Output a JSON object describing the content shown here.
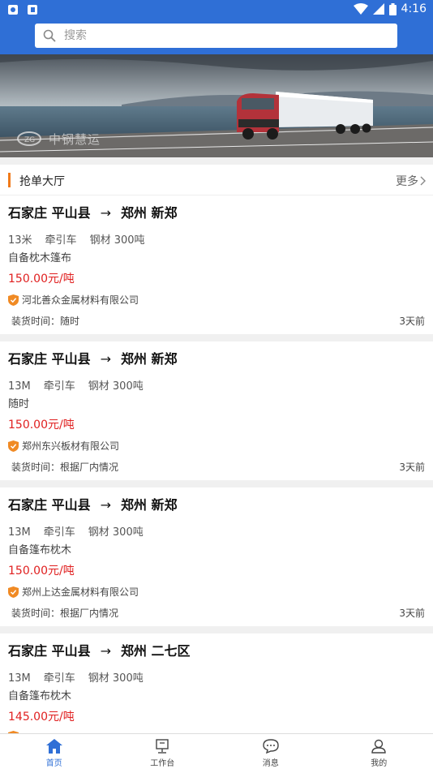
{
  "status_bar": {
    "time": "4:16"
  },
  "search": {
    "placeholder": "搜索"
  },
  "banner": {
    "watermark": "中钢慧运"
  },
  "section": {
    "title": "抢单大厅",
    "more": "更多"
  },
  "orders": [
    {
      "origin": "石家庄 平山县",
      "arrow": "→",
      "destination": "郑州 新郑",
      "length": "13米",
      "vehicle": "牵引车",
      "cargo": "钢材 300吨",
      "note": "自备枕木篷布",
      "price": "150.00元/吨",
      "company": "河北善众金属材料有限公司",
      "load_time": "装货时间：随时",
      "posted": "3天前"
    },
    {
      "origin": "石家庄 平山县",
      "arrow": "→",
      "destination": "郑州 新郑",
      "length": "13M",
      "vehicle": "牵引车",
      "cargo": "钢材 300吨",
      "note": "随时",
      "price": "150.00元/吨",
      "company": "郑州东兴板材有限公司",
      "load_time": "装货时间：根据厂内情况",
      "posted": "3天前"
    },
    {
      "origin": "石家庄 平山县",
      "arrow": "→",
      "destination": "郑州 新郑",
      "length": "13M",
      "vehicle": "牵引车",
      "cargo": "钢材 300吨",
      "note": "自备篷布枕木",
      "price": "150.00元/吨",
      "company": "郑州上达金属材料有限公司",
      "load_time": "装货时间：根据厂内情况",
      "posted": "3天前"
    },
    {
      "origin": "石家庄 平山县",
      "arrow": "→",
      "destination": "郑州 二七区",
      "length": "13M",
      "vehicle": "牵引车",
      "cargo": "钢材 300吨",
      "note": "自备篷布枕木",
      "price": "145.00元/吨",
      "company": "",
      "load_time": "",
      "posted": ""
    }
  ],
  "tabs": [
    {
      "label": "首页",
      "icon": "home-icon",
      "active": true
    },
    {
      "label": "工作台",
      "icon": "workbench-icon",
      "active": false
    },
    {
      "label": "消息",
      "icon": "message-icon",
      "active": false
    },
    {
      "label": "我的",
      "icon": "user-icon",
      "active": false
    }
  ],
  "colors": {
    "primary": "#2f6fd6",
    "price": "#e02020",
    "accent": "#f07a1a"
  }
}
